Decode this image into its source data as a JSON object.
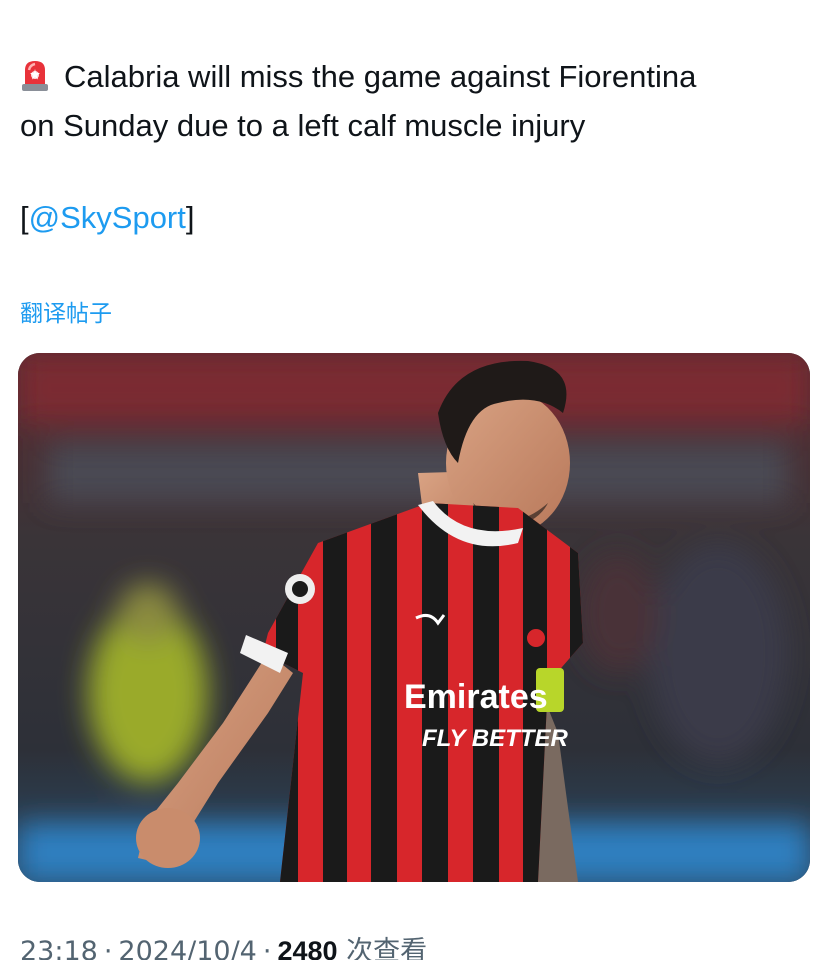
{
  "tweet": {
    "line1": "Calabria will miss the game against Fiorentina",
    "line2": "on Sunday due to a left calf muscle injury",
    "source_open": "[",
    "source_mention": "@SkySport",
    "source_close": "]",
    "translate_label": "翻译帖子"
  },
  "media": {
    "description_icon": "photo",
    "jersey_sponsor_line1": "Emirates",
    "jersey_sponsor_line2": "FLY BETTER"
  },
  "meta": {
    "time": "23:18",
    "separator": "·",
    "date": "2024/10/4",
    "views_count": "2480",
    "views_label": "次查看"
  },
  "colors": {
    "link": "#1d9bf0",
    "text": "#0f1419",
    "muted": "#536471",
    "jersey_red": "#d7262b",
    "jersey_black": "#1a1a1a"
  }
}
